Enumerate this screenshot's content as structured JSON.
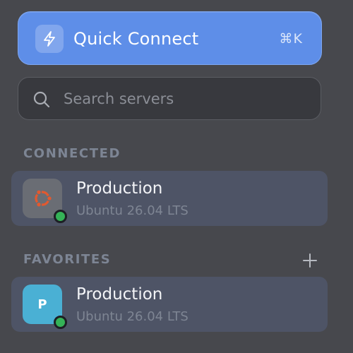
{
  "quick_connect": {
    "label": "Quick Connect",
    "shortcut": "⌘K",
    "icon": "bolt-icon",
    "color": "#5e8ee8"
  },
  "search": {
    "placeholder": "Search servers",
    "value": "",
    "icon": "search-icon"
  },
  "sections": {
    "connected": {
      "title": "CONNECTED",
      "servers": [
        {
          "name": "Production",
          "os": "Ubuntu 26.04 LTS",
          "avatar": "ubuntu-logo-icon",
          "status": "online",
          "status_color": "#35b257"
        }
      ]
    },
    "favorites": {
      "title": "FAVORITES",
      "add_icon": "plus-icon",
      "servers": [
        {
          "name": "Production",
          "os": "Ubuntu 26.04 LTS",
          "avatar_letter": "P",
          "avatar_color": "#4ab0d4",
          "status": "online",
          "status_color": "#35b257"
        }
      ]
    }
  }
}
